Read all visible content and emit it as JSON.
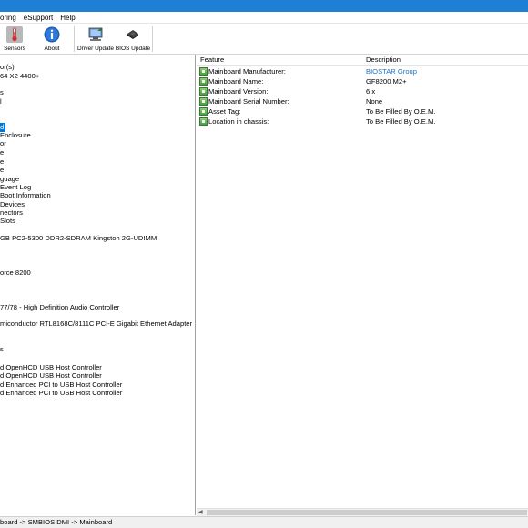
{
  "menu": [
    "oring",
    "eSupport",
    "Help"
  ],
  "toolbar": {
    "sensors": "Sensors",
    "about": "About",
    "driver_update": "Driver Update",
    "bios_update": "BIOS Update"
  },
  "tree": [
    "or(s)",
    " 64 X2 4400+",
    "s",
    "l",
    "d",
    "Enclosure",
    "or",
    "e",
    "e",
    "e",
    "guage",
    "Event Log",
    "Boot Information",
    "Devices",
    "nectors",
    "Slots",
    "GB PC2-5300 DDR2-SDRAM Kingston 2G-UDIMM",
    "orce 8200",
    "77/78 - High Definition Audio Controller",
    "miconductor RTL8168C/8111C PCI-E Gigabit Ethernet Adapter",
    "s",
    "d OpenHCD USB Host Controller",
    "d OpenHCD USB Host Controller",
    "d Enhanced PCI to USB Host Controller",
    "d Enhanced PCI to USB Host Controller"
  ],
  "table": {
    "headers": {
      "feature": "Feature",
      "description": "Description"
    },
    "rows": [
      {
        "feature": "Mainboard Manufacturer:",
        "description": "BIOSTAR Group"
      },
      {
        "feature": "Mainboard Name:",
        "description": "GF8200 M2+"
      },
      {
        "feature": "Mainboard Version:",
        "description": "6.x"
      },
      {
        "feature": "Mainboard Serial Number:",
        "description": "None"
      },
      {
        "feature": "Asset Tag:",
        "description": "To Be Filled By O.E.M."
      },
      {
        "feature": "Location in chassis:",
        "description": "To Be Filled By O.E.M."
      }
    ]
  },
  "status": "board -> SMBIOS DMI -> Mainboard",
  "colors": {
    "titlebar": "#1e7fd4",
    "selection": "#0078d7",
    "link": "#1a73c9"
  }
}
